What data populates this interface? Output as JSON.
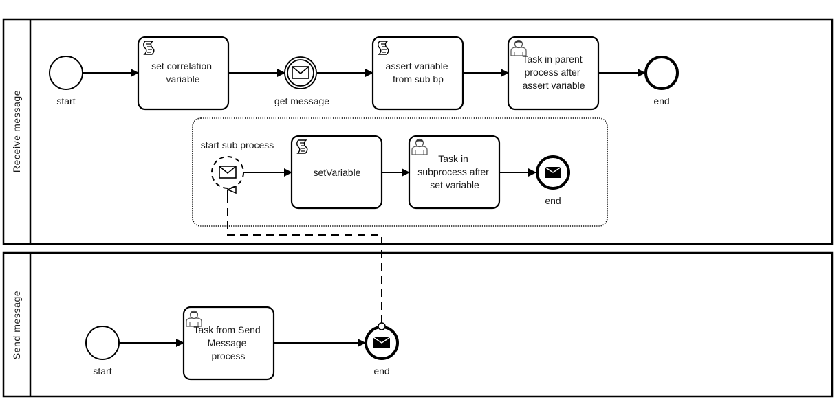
{
  "diagram": {
    "type": "BPMN collaboration",
    "pools": [
      {
        "id": "pool-receive",
        "label": "Receive message",
        "elements": {
          "start": {
            "label": "start",
            "kind": "start-event"
          },
          "set_correlation": {
            "label_lines": [
              "set correlation",
              "variable"
            ],
            "kind": "script-task",
            "icon": "script-icon"
          },
          "get_message": {
            "label": "get message",
            "kind": "intermediate-catch-message-event",
            "icon": "envelope-icon"
          },
          "assert_variable": {
            "label_lines": [
              "assert variable",
              "from sub bp"
            ],
            "kind": "script-task",
            "icon": "script-icon"
          },
          "task_parent": {
            "label_lines": [
              "Task in parent",
              "process after",
              "assert variable"
            ],
            "kind": "user-task",
            "icon": "user-icon"
          },
          "end": {
            "label": "end",
            "kind": "end-event"
          }
        },
        "subprocess": {
          "kind": "event-subprocess",
          "elements": {
            "start_sub": {
              "label": "start sub process",
              "kind": "non-interrupting-message-start-event",
              "icon": "envelope-icon"
            },
            "set_variable": {
              "label_lines": [
                "setVariable"
              ],
              "kind": "script-task",
              "icon": "script-icon"
            },
            "task_sub": {
              "label_lines": [
                "Task in",
                "subprocess after",
                "set variable"
              ],
              "kind": "user-task",
              "icon": "user-icon"
            },
            "end_sub": {
              "label": "end",
              "kind": "message-end-event",
              "icon": "envelope-filled-icon"
            }
          }
        }
      },
      {
        "id": "pool-send",
        "label": "Send message",
        "elements": {
          "start": {
            "label": "start",
            "kind": "start-event"
          },
          "task_send": {
            "label_lines": [
              "Task from Send",
              "Message",
              "process"
            ],
            "kind": "user-task",
            "icon": "user-icon"
          },
          "end": {
            "label": "end",
            "kind": "message-end-event",
            "icon": "envelope-filled-icon"
          }
        }
      }
    ],
    "sequence_flows": [
      [
        "pool-receive.start",
        "set_correlation"
      ],
      [
        "set_correlation",
        "get_message"
      ],
      [
        "get_message",
        "assert_variable"
      ],
      [
        "assert_variable",
        "task_parent"
      ],
      [
        "task_parent",
        "pool-receive.end"
      ],
      [
        "start_sub",
        "set_variable"
      ],
      [
        "set_variable",
        "task_sub"
      ],
      [
        "task_sub",
        "end_sub"
      ],
      [
        "pool-send.start",
        "task_send"
      ],
      [
        "task_send",
        "pool-send.end"
      ]
    ],
    "message_flows": [
      [
        "pool-send.end",
        "start_sub"
      ]
    ],
    "colors": {
      "stroke": "#000000",
      "text": "#1a1a1a",
      "background": "#ffffff"
    }
  }
}
